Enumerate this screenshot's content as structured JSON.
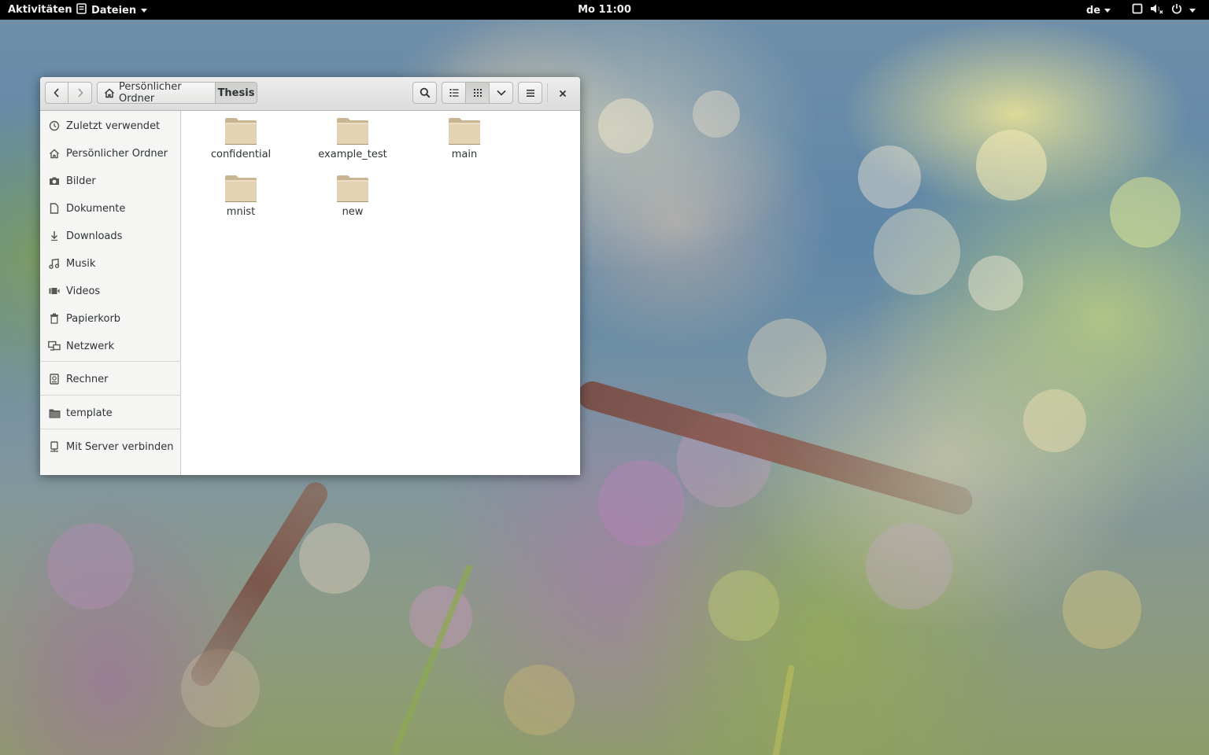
{
  "topbar": {
    "activities": "Aktivitäten",
    "app_name": "Dateien",
    "clock": "Mo 11:00",
    "language": "de",
    "status_icons": [
      "window-icon",
      "volume-muted-icon",
      "power-icon"
    ]
  },
  "window": {
    "path": {
      "home_label": "Persönlicher Ordner",
      "current_label": "Thesis"
    },
    "toolbar_icons": [
      "search-icon",
      "list-view-icon",
      "grid-view-icon",
      "chevron-down-icon",
      "menu-icon",
      "close-icon"
    ],
    "sidebar": {
      "items": [
        {
          "label": "Zuletzt verwendet",
          "icon": "recent-icon"
        },
        {
          "label": "Persönlicher Ordner",
          "icon": "home-icon"
        },
        {
          "label": "Bilder",
          "icon": "camera-icon"
        },
        {
          "label": "Dokumente",
          "icon": "document-icon"
        },
        {
          "label": "Downloads",
          "icon": "download-icon"
        },
        {
          "label": "Musik",
          "icon": "music-icon"
        },
        {
          "label": "Videos",
          "icon": "video-icon"
        },
        {
          "label": "Papierkorb",
          "icon": "trash-icon"
        },
        {
          "label": "Netzwerk",
          "icon": "network-icon"
        }
      ],
      "devices": [
        {
          "label": "Rechner",
          "icon": "drive-icon"
        }
      ],
      "bookmarks": [
        {
          "label": "template",
          "icon": "folder-icon"
        }
      ],
      "connect": {
        "label": "Mit Server verbinden",
        "icon": "server-icon"
      }
    },
    "files": [
      {
        "name": "confidential"
      },
      {
        "name": "example_test"
      },
      {
        "name": "main"
      },
      {
        "name": "mnist"
      },
      {
        "name": "new"
      }
    ]
  },
  "colors": {
    "topbar_bg": "#000000",
    "folder_body": "#e3d2b4",
    "folder_tab": "#c9b592",
    "sidebar_bg": "#f5f5f4"
  }
}
